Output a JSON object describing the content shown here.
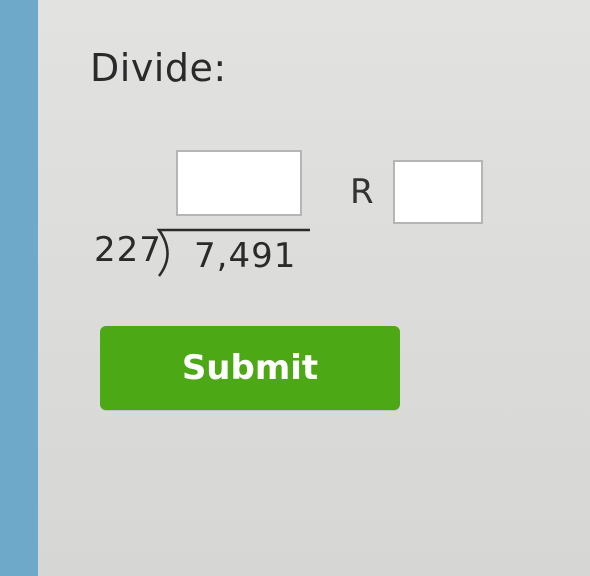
{
  "problem": {
    "prompt": "Divide:",
    "divisor": "227",
    "dividend": "7,491",
    "remainder_label": "R",
    "quotient_value": "",
    "remainder_value": ""
  },
  "submit": {
    "label": "Submit"
  },
  "colors": {
    "panel_background": "#dcdcda",
    "page_edge": "#6fa9c9",
    "submit_background": "#4ca814",
    "submit_text": "#ffffff"
  }
}
